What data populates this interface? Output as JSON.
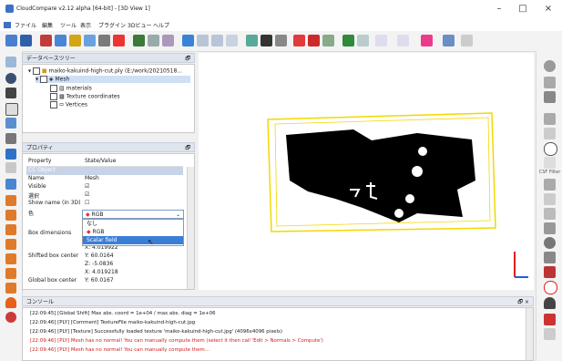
{
  "window": {
    "title": "CloudCompare v2.12 alpha [64-bit] - [3D View 1]",
    "min": "–",
    "max": "□",
    "close": "×"
  },
  "menu": [
    "ファイル",
    "編集",
    "ツール",
    "表示",
    "プラグイン",
    "3Dビュー",
    "ヘルプ"
  ],
  "db_tree": {
    "title": "データベースツリー",
    "root": "maiko-kakuind-high-cut.ply (E:/work/20210518...",
    "mesh": "Mesh",
    "children": [
      "materials",
      "Texture coordinates",
      "Vertices"
    ]
  },
  "properties": {
    "title": "プロパティ",
    "header_property": "Property",
    "header_value": "State/Value",
    "section": "CC Object",
    "rows": [
      {
        "k": "Name",
        "v": "Mesh"
      },
      {
        "k": "Visible",
        "v": "☑"
      },
      {
        "k": "選択",
        "v": "☑"
      },
      {
        "k": "Show name (in 3D)",
        "v": "☐"
      },
      {
        "k": "色",
        "v": ""
      },
      {
        "k": "Box dimensions",
        "v": ""
      },
      {
        "k": "",
        "v": "X: 4.019922"
      },
      {
        "k": "Shifted box center",
        "v": "Y: 60.0164"
      },
      {
        "k": "",
        "v": "Z: -5.0836"
      },
      {
        "k": "",
        "v": "X: 4.019218"
      },
      {
        "k": "Global box center",
        "v": "Y: 60.0167"
      }
    ],
    "color_combo": "RGB",
    "dropdown": [
      "なし",
      "RGB",
      "Scalar field"
    ]
  },
  "console": {
    "title": "コンソール",
    "lines": [
      "[22:09:45] [Global Shift] Max abs. coord = 1e+04 / max abs. diag = 1e+06",
      "[22:09:46] [PLY] [Comment] TextureFile maiko-kakuind-high-cut.jpg",
      "[22:09:46] [PLY] [Texture] Successfully loaded texture 'maiko-kakuind-high-cut.jpg' (4096x4096 pixels)",
      "[22:09:46] [PLY] Mesh has no normal! You can manually compute them (select it then call 'Edit > Normals > Compute')",
      "[22:09:46] [PLY] Mesh has no normal! You can manually compute them..."
    ]
  },
  "right_toolbar_label": "CSF Filter",
  "colors": {
    "accent": "#2f6fc7",
    "bbox": "#f2d800",
    "axis_red": "#e02020",
    "axis_blue": "#2060e0",
    "error": "#cc2020"
  }
}
